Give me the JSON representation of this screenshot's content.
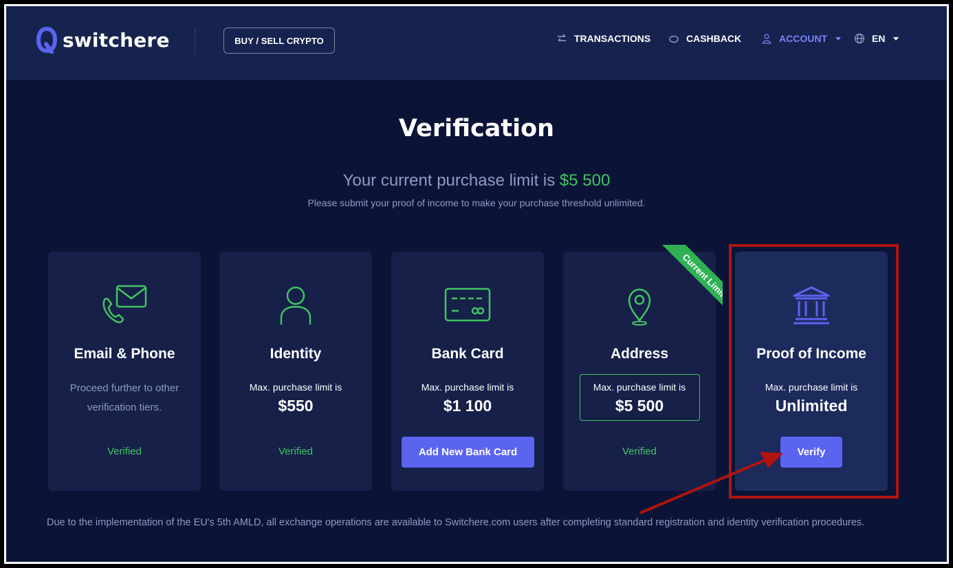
{
  "header": {
    "logo_text": "switchere",
    "buy_sell_label": "BUY / SELL CRYPTO",
    "nav": {
      "transactions": "TRANSACTIONS",
      "cashback": "CASHBACK",
      "account": "ACCOUNT",
      "language": "EN"
    }
  },
  "main": {
    "title": "Verification",
    "limit_prefix": "Your current purchase limit is ",
    "limit_amount": "$5 500",
    "subtitle": "Please submit your proof of income to make your purchase threshold unlimited."
  },
  "cards": [
    {
      "title": "Email & Phone",
      "description": "Proceed further to other verification tiers.",
      "status": "Verified",
      "icon": "email-phone-icon"
    },
    {
      "title": "Identity",
      "limit_label": "Max. purchase limit is",
      "limit_value": "$550",
      "status": "Verified",
      "icon": "user-icon"
    },
    {
      "title": "Bank Card",
      "limit_label": "Max. purchase limit is",
      "limit_value": "$1 100",
      "button": "Add New Bank Card",
      "icon": "credit-card-icon"
    },
    {
      "title": "Address",
      "limit_label": "Max. purchase limit is",
      "limit_value": "$5 500",
      "status": "Verified",
      "ribbon": "Current Limit",
      "icon": "location-pin-icon"
    },
    {
      "title": "Proof of Income",
      "limit_label": "Max. purchase limit is",
      "limit_value": "Unlimited",
      "button": "Verify",
      "icon": "bank-icon"
    }
  ],
  "footnote": "Due to the implementation of the EU's 5th AMLD, all exchange operations are available to Switchere.com users after completing standard registration and identity verification procedures.",
  "colors": {
    "background": "#0b1437",
    "header": "#16234f",
    "card": "#162049",
    "accent_green": "#3fc660",
    "accent_purple": "#5b64ef",
    "highlight_red": "#b0140e"
  }
}
